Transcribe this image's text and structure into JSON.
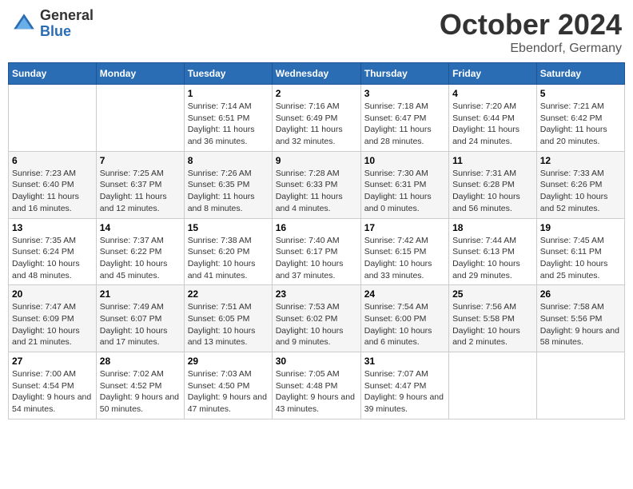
{
  "header": {
    "logo_general": "General",
    "logo_blue": "Blue",
    "month_title": "October 2024",
    "location": "Ebendorf, Germany"
  },
  "weekdays": [
    "Sunday",
    "Monday",
    "Tuesday",
    "Wednesday",
    "Thursday",
    "Friday",
    "Saturday"
  ],
  "weeks": [
    [
      {
        "day": "",
        "info": ""
      },
      {
        "day": "",
        "info": ""
      },
      {
        "day": "1",
        "info": "Sunrise: 7:14 AM\nSunset: 6:51 PM\nDaylight: 11 hours and 36 minutes."
      },
      {
        "day": "2",
        "info": "Sunrise: 7:16 AM\nSunset: 6:49 PM\nDaylight: 11 hours and 32 minutes."
      },
      {
        "day": "3",
        "info": "Sunrise: 7:18 AM\nSunset: 6:47 PM\nDaylight: 11 hours and 28 minutes."
      },
      {
        "day": "4",
        "info": "Sunrise: 7:20 AM\nSunset: 6:44 PM\nDaylight: 11 hours and 24 minutes."
      },
      {
        "day": "5",
        "info": "Sunrise: 7:21 AM\nSunset: 6:42 PM\nDaylight: 11 hours and 20 minutes."
      }
    ],
    [
      {
        "day": "6",
        "info": "Sunrise: 7:23 AM\nSunset: 6:40 PM\nDaylight: 11 hours and 16 minutes."
      },
      {
        "day": "7",
        "info": "Sunrise: 7:25 AM\nSunset: 6:37 PM\nDaylight: 11 hours and 12 minutes."
      },
      {
        "day": "8",
        "info": "Sunrise: 7:26 AM\nSunset: 6:35 PM\nDaylight: 11 hours and 8 minutes."
      },
      {
        "day": "9",
        "info": "Sunrise: 7:28 AM\nSunset: 6:33 PM\nDaylight: 11 hours and 4 minutes."
      },
      {
        "day": "10",
        "info": "Sunrise: 7:30 AM\nSunset: 6:31 PM\nDaylight: 11 hours and 0 minutes."
      },
      {
        "day": "11",
        "info": "Sunrise: 7:31 AM\nSunset: 6:28 PM\nDaylight: 10 hours and 56 minutes."
      },
      {
        "day": "12",
        "info": "Sunrise: 7:33 AM\nSunset: 6:26 PM\nDaylight: 10 hours and 52 minutes."
      }
    ],
    [
      {
        "day": "13",
        "info": "Sunrise: 7:35 AM\nSunset: 6:24 PM\nDaylight: 10 hours and 48 minutes."
      },
      {
        "day": "14",
        "info": "Sunrise: 7:37 AM\nSunset: 6:22 PM\nDaylight: 10 hours and 45 minutes."
      },
      {
        "day": "15",
        "info": "Sunrise: 7:38 AM\nSunset: 6:20 PM\nDaylight: 10 hours and 41 minutes."
      },
      {
        "day": "16",
        "info": "Sunrise: 7:40 AM\nSunset: 6:17 PM\nDaylight: 10 hours and 37 minutes."
      },
      {
        "day": "17",
        "info": "Sunrise: 7:42 AM\nSunset: 6:15 PM\nDaylight: 10 hours and 33 minutes."
      },
      {
        "day": "18",
        "info": "Sunrise: 7:44 AM\nSunset: 6:13 PM\nDaylight: 10 hours and 29 minutes."
      },
      {
        "day": "19",
        "info": "Sunrise: 7:45 AM\nSunset: 6:11 PM\nDaylight: 10 hours and 25 minutes."
      }
    ],
    [
      {
        "day": "20",
        "info": "Sunrise: 7:47 AM\nSunset: 6:09 PM\nDaylight: 10 hours and 21 minutes."
      },
      {
        "day": "21",
        "info": "Sunrise: 7:49 AM\nSunset: 6:07 PM\nDaylight: 10 hours and 17 minutes."
      },
      {
        "day": "22",
        "info": "Sunrise: 7:51 AM\nSunset: 6:05 PM\nDaylight: 10 hours and 13 minutes."
      },
      {
        "day": "23",
        "info": "Sunrise: 7:53 AM\nSunset: 6:02 PM\nDaylight: 10 hours and 9 minutes."
      },
      {
        "day": "24",
        "info": "Sunrise: 7:54 AM\nSunset: 6:00 PM\nDaylight: 10 hours and 6 minutes."
      },
      {
        "day": "25",
        "info": "Sunrise: 7:56 AM\nSunset: 5:58 PM\nDaylight: 10 hours and 2 minutes."
      },
      {
        "day": "26",
        "info": "Sunrise: 7:58 AM\nSunset: 5:56 PM\nDaylight: 9 hours and 58 minutes."
      }
    ],
    [
      {
        "day": "27",
        "info": "Sunrise: 7:00 AM\nSunset: 4:54 PM\nDaylight: 9 hours and 54 minutes."
      },
      {
        "day": "28",
        "info": "Sunrise: 7:02 AM\nSunset: 4:52 PM\nDaylight: 9 hours and 50 minutes."
      },
      {
        "day": "29",
        "info": "Sunrise: 7:03 AM\nSunset: 4:50 PM\nDaylight: 9 hours and 47 minutes."
      },
      {
        "day": "30",
        "info": "Sunrise: 7:05 AM\nSunset: 4:48 PM\nDaylight: 9 hours and 43 minutes."
      },
      {
        "day": "31",
        "info": "Sunrise: 7:07 AM\nSunset: 4:47 PM\nDaylight: 9 hours and 39 minutes."
      },
      {
        "day": "",
        "info": ""
      },
      {
        "day": "",
        "info": ""
      }
    ]
  ]
}
